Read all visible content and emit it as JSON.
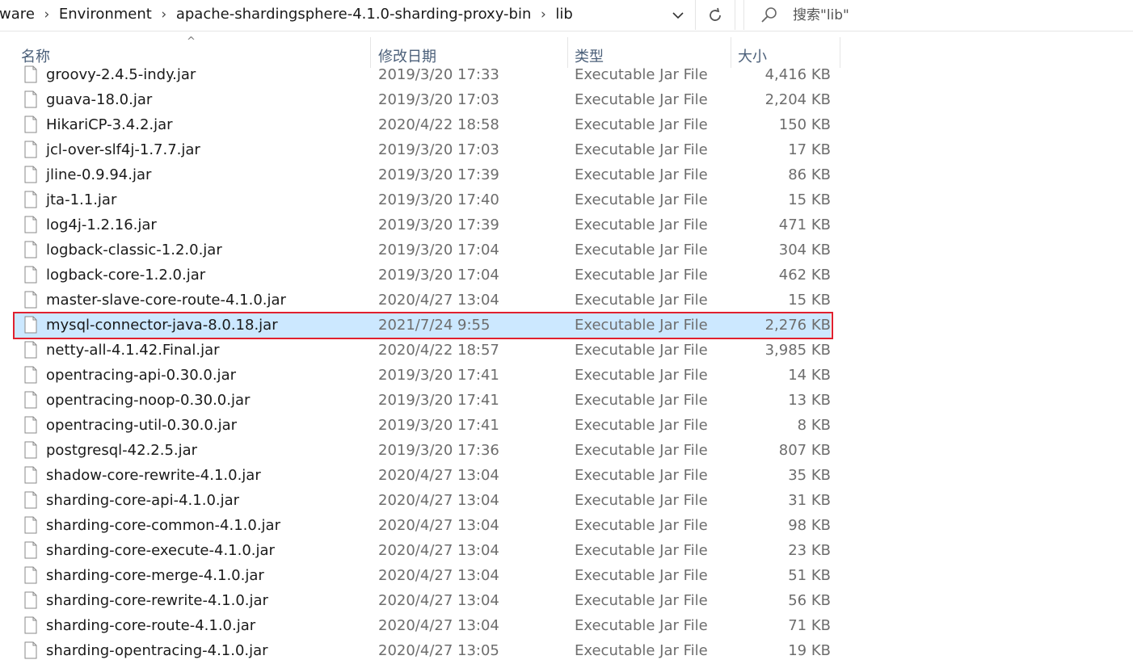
{
  "address_bar": {
    "breadcrumbs": [
      "tware",
      "Environment",
      "apache-shardingsphere-4.1.0-sharding-proxy-bin",
      "lib"
    ],
    "separator": "›",
    "dropdown_icon": "chevron-down-icon",
    "refresh_icon": "refresh-icon"
  },
  "search": {
    "placeholder": "搜索\"lib\"",
    "icon": "search-icon"
  },
  "columns": {
    "name": "名称",
    "date": "修改日期",
    "type": "类型",
    "size": "大小",
    "sort_indicator": "^"
  },
  "files": [
    {
      "name": "groovy-2.4.5-indy.jar",
      "date": "2019/3/20 17:33",
      "type": "Executable Jar File",
      "size": "4,416 KB"
    },
    {
      "name": "guava-18.0.jar",
      "date": "2019/3/20 17:03",
      "type": "Executable Jar File",
      "size": "2,204 KB"
    },
    {
      "name": "HikariCP-3.4.2.jar",
      "date": "2020/4/22 18:58",
      "type": "Executable Jar File",
      "size": "150 KB"
    },
    {
      "name": "jcl-over-slf4j-1.7.7.jar",
      "date": "2019/3/20 17:03",
      "type": "Executable Jar File",
      "size": "17 KB"
    },
    {
      "name": "jline-0.9.94.jar",
      "date": "2019/3/20 17:39",
      "type": "Executable Jar File",
      "size": "86 KB"
    },
    {
      "name": "jta-1.1.jar",
      "date": "2019/3/20 17:40",
      "type": "Executable Jar File",
      "size": "15 KB"
    },
    {
      "name": "log4j-1.2.16.jar",
      "date": "2019/3/20 17:39",
      "type": "Executable Jar File",
      "size": "471 KB"
    },
    {
      "name": "logback-classic-1.2.0.jar",
      "date": "2019/3/20 17:04",
      "type": "Executable Jar File",
      "size": "304 KB"
    },
    {
      "name": "logback-core-1.2.0.jar",
      "date": "2019/3/20 17:04",
      "type": "Executable Jar File",
      "size": "462 KB"
    },
    {
      "name": "master-slave-core-route-4.1.0.jar",
      "date": "2020/4/27 13:04",
      "type": "Executable Jar File",
      "size": "15 KB"
    },
    {
      "name": "mysql-connector-java-8.0.18.jar",
      "date": "2021/7/24 9:55",
      "type": "Executable Jar File",
      "size": "2,276 KB",
      "selected": true
    },
    {
      "name": "netty-all-4.1.42.Final.jar",
      "date": "2020/4/22 18:57",
      "type": "Executable Jar File",
      "size": "3,985 KB"
    },
    {
      "name": "opentracing-api-0.30.0.jar",
      "date": "2019/3/20 17:41",
      "type": "Executable Jar File",
      "size": "14 KB"
    },
    {
      "name": "opentracing-noop-0.30.0.jar",
      "date": "2019/3/20 17:41",
      "type": "Executable Jar File",
      "size": "13 KB"
    },
    {
      "name": "opentracing-util-0.30.0.jar",
      "date": "2019/3/20 17:41",
      "type": "Executable Jar File",
      "size": "8 KB"
    },
    {
      "name": "postgresql-42.2.5.jar",
      "date": "2019/3/20 17:36",
      "type": "Executable Jar File",
      "size": "807 KB"
    },
    {
      "name": "shadow-core-rewrite-4.1.0.jar",
      "date": "2020/4/27 13:04",
      "type": "Executable Jar File",
      "size": "35 KB"
    },
    {
      "name": "sharding-core-api-4.1.0.jar",
      "date": "2020/4/27 13:04",
      "type": "Executable Jar File",
      "size": "31 KB"
    },
    {
      "name": "sharding-core-common-4.1.0.jar",
      "date": "2020/4/27 13:04",
      "type": "Executable Jar File",
      "size": "98 KB"
    },
    {
      "name": "sharding-core-execute-4.1.0.jar",
      "date": "2020/4/27 13:04",
      "type": "Executable Jar File",
      "size": "23 KB"
    },
    {
      "name": "sharding-core-merge-4.1.0.jar",
      "date": "2020/4/27 13:04",
      "type": "Executable Jar File",
      "size": "51 KB"
    },
    {
      "name": "sharding-core-rewrite-4.1.0.jar",
      "date": "2020/4/27 13:04",
      "type": "Executable Jar File",
      "size": "56 KB"
    },
    {
      "name": "sharding-core-route-4.1.0.jar",
      "date": "2020/4/27 13:04",
      "type": "Executable Jar File",
      "size": "71 KB"
    },
    {
      "name": "sharding-opentracing-4.1.0.jar",
      "date": "2020/4/27 13:05",
      "type": "Executable Jar File",
      "size": "19 KB"
    }
  ],
  "file_icon": "file-icon",
  "colors": {
    "selection": "#cce8ff",
    "highlight_border": "#e0212f",
    "header_text": "#4c607a",
    "secondary_text": "#6d6d6d"
  }
}
